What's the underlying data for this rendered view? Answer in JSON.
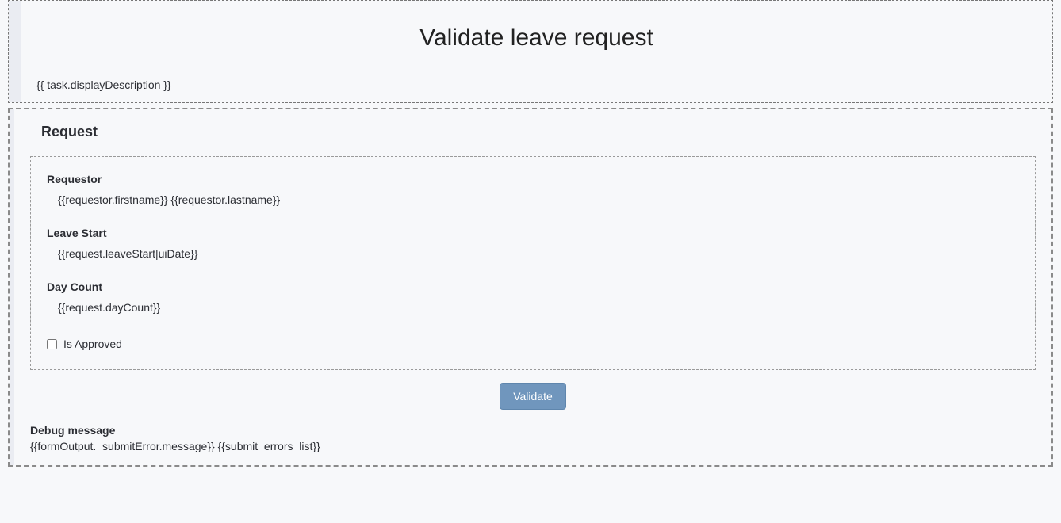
{
  "header": {
    "title": "Validate leave request",
    "task_description": "{{ task.displayDescription }}"
  },
  "request": {
    "section_heading": "Request",
    "fields": {
      "requestor_label": "Requestor",
      "requestor_value": "{{requestor.firstname}} {{requestor.lastname}}",
      "leavestart_label": "Leave Start",
      "leavestart_value": "{{request.leaveStart|uiDate}}",
      "daycount_label": "Day Count",
      "daycount_value": "{{request.dayCount}}"
    },
    "approve_checkbox_label": "Is Approved"
  },
  "actions": {
    "validate_label": "Validate"
  },
  "debug": {
    "label": "Debug message",
    "text": "{{formOutput._submitError.message}} {{submit_errors_list}}"
  }
}
